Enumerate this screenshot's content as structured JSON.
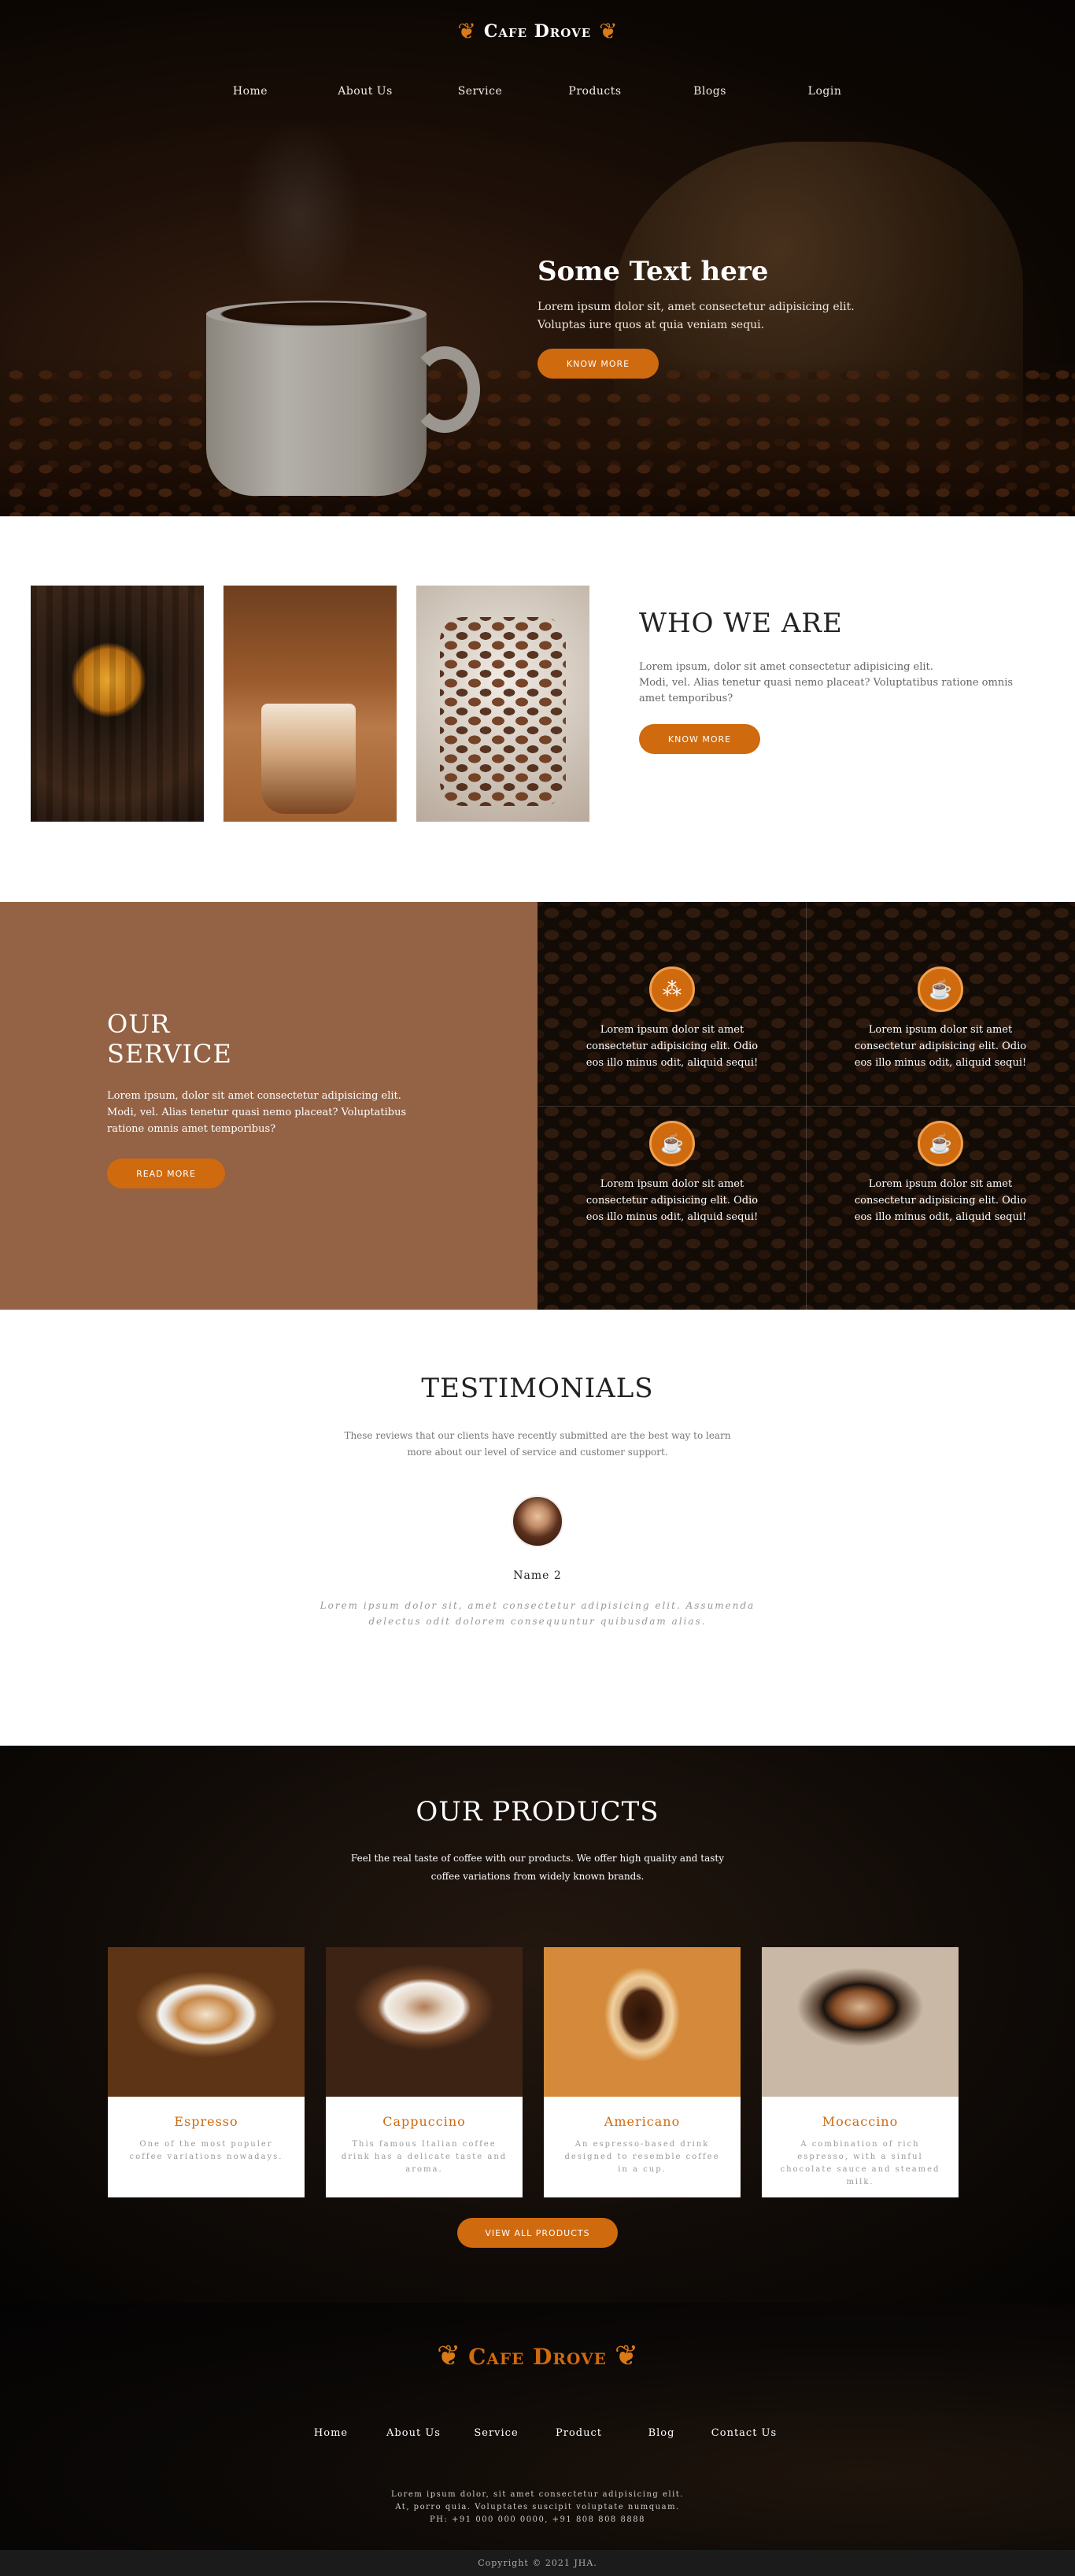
{
  "brand": {
    "name": "Cafe Drove",
    "icon": "butterfly-icon",
    "accent": "#d06a0e"
  },
  "nav": [
    "Home",
    "About Us",
    "Service",
    "Products",
    "Blogs",
    "Login"
  ],
  "hero": {
    "title": "Some Text here",
    "text_line1": "Lorem ipsum dolor sit, amet consectetur adipisicing elit.",
    "text_line2": "Voluptas iure quos at quia veniam sequi.",
    "button": "KNOW MORE"
  },
  "who": {
    "title": "WHO WE ARE",
    "text_line1": "Lorem ipsum, dolor sit amet consectetur adipisicing elit.",
    "text_line2": "Modi, vel. Alias tenetur quasi nemo placeat? Voluptatibus ratione omnis amet temporibus?",
    "button": "KNOW MORE"
  },
  "service": {
    "title_line1": "OUR",
    "title_line2": "SERVICE",
    "text_line1": "Lorem ipsum, dolor sit amet consectetur adipisicing elit.",
    "text_line2": "Modi, vel. Alias tenetur quasi nemo placeat? Voluptatibus ratione omnis amet temporibus?",
    "button": "READ MORE",
    "items": [
      {
        "icon": "coffee-beans-icon",
        "text": "Lorem ipsum dolor sit amet consectetur adipisicing elit. Odio eos illo minus odit, aliquid sequi!"
      },
      {
        "icon": "coffee-bag-icon",
        "text": "Lorem ipsum dolor sit amet consectetur adipisicing elit. Odio eos illo minus odit, aliquid sequi!"
      },
      {
        "icon": "coffee-cup-icon",
        "text": "Lorem ipsum dolor sit amet consectetur adipisicing elit. Odio eos illo minus odit, aliquid sequi!"
      },
      {
        "icon": "coffee-mug-icon",
        "text": "Lorem ipsum dolor sit amet consectetur adipisicing elit. Odio eos illo minus odit, aliquid sequi!"
      }
    ]
  },
  "testimonials": {
    "title": "TESTIMONIALS",
    "subtitle": "These reviews that our clients have recently submitted are the best way to learn more about our level of service and customer support.",
    "name": "Name 2",
    "quote": "Lorem ipsum dolor sit, amet consectetur adipisicing elit. Assumenda delectus odit dolorem consequuntur quibusdam alias."
  },
  "products": {
    "title": "OUR PRODUCTS",
    "subtitle": "Feel the real taste of coffee with our products. We offer high quality and tasty coffee variations from widely known brands.",
    "button": "VIEW ALL PRODUCTS",
    "items": [
      {
        "name": "Espresso",
        "desc": "One of the most populer coffee variations nowadays."
      },
      {
        "name": "Cappuccino",
        "desc": "This famous Italian coffee drink has a delicate taste and aroma."
      },
      {
        "name": "Americano",
        "desc": "An espresso-based drink designed to resemble coffee in a cup."
      },
      {
        "name": "Mocaccino",
        "desc": "A combination of rich espresso, with a sinful chocolate sauce and steamed milk."
      }
    ]
  },
  "footer": {
    "nav": [
      "Home",
      "About Us",
      "Service",
      "Product",
      "Blog",
      "Contact Us"
    ],
    "line1": "Lorem ipsum dolor, sit amet consectetur adipisicing elit.",
    "line2": "At, porro quia. Voluptates suscipit voluptate numquam.",
    "line3": "PH: +91 000 000 0000, +91 808 808 8888",
    "copyright": "Copyright © 2021 JHA."
  }
}
